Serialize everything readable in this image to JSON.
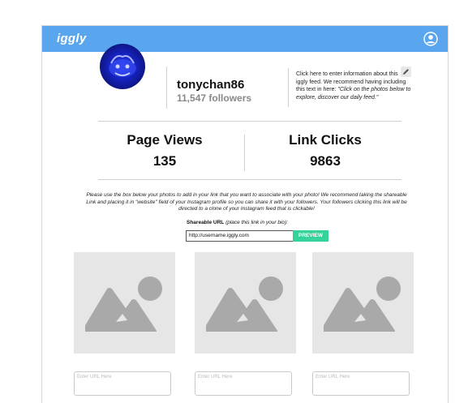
{
  "app": {
    "logo": "iggly"
  },
  "profile": {
    "username": "tonychan86",
    "followers": "11,547 followers",
    "bio_text": "Click here to enter information about this iggly feed. We recommend having including this text in here: ",
    "bio_italic": "\"Click on the photos below to explore, discover our daily feed.\""
  },
  "stats": {
    "page_views_label": "Page Views",
    "page_views_value": "135",
    "link_clicks_label": "Link Clicks",
    "link_clicks_value": "9863"
  },
  "instructions": "Please use the box below your photos to add in your link that you want to associate with your photo! We recommend taking the shareable Link and placing it in \"website\" field of your Instagram profile so you can share it with your followers. Your followers clicking this link will be directed to a clone of your Instagram feed that is clickable!",
  "share": {
    "label": "Shareable URL",
    "hint": "(place this link in your bio):",
    "url_value": "http://username.iggly.com",
    "preview_label": "PREVIEW"
  },
  "photos": [
    {
      "url_placeholder": "Enter URL Here"
    },
    {
      "url_placeholder": "Enter URL Here"
    },
    {
      "url_placeholder": "Enter URL Here"
    }
  ],
  "colors": {
    "topbar": "#5aa6ee",
    "preview": "#34d399",
    "placeholder_bg": "#e6e6e6"
  },
  "icons": {
    "user": "user-circle-icon",
    "edit": "pencil-icon",
    "photo": "image-placeholder-icon"
  }
}
